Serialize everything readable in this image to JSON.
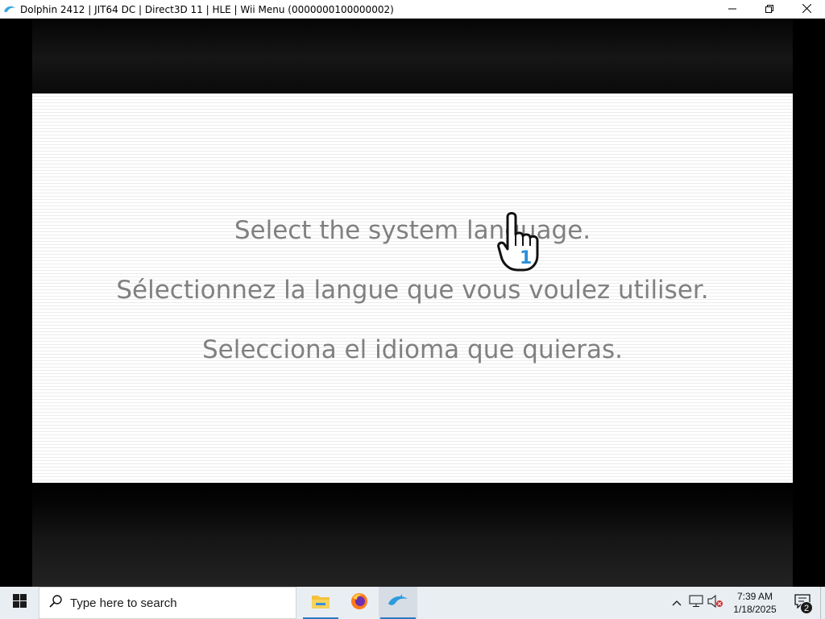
{
  "window": {
    "title": "Dolphin 2412 | JIT64 DC | Direct3D 11 | HLE | Wii Menu (0000000100000002)",
    "minimize_icon": "minimize-icon",
    "restore_icon": "restore-icon",
    "close_icon": "close-icon"
  },
  "game": {
    "prompts": [
      "Select the system language.",
      "Sélectionnez la langue que vous voulez utiliser.",
      "Selecciona el idioma que quieras."
    ],
    "cursor_player": "1",
    "colors": {
      "text": "#808080",
      "cursor_accent": "#2b8fd8"
    }
  },
  "taskbar": {
    "search_placeholder": "Type here to search",
    "apps": [
      {
        "name": "file-explorer",
        "active": false
      },
      {
        "name": "firefox",
        "active": false
      },
      {
        "name": "dolphin",
        "active": true
      }
    ],
    "clock_time": "7:39 AM",
    "clock_date": "1/18/2025",
    "notification_count": "2"
  }
}
